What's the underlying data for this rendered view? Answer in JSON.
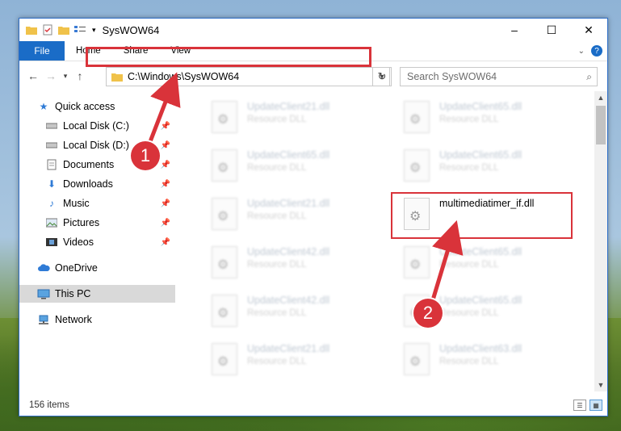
{
  "window": {
    "title": "SysWOW64",
    "controls": {
      "minimize": "–",
      "maximize": "☐",
      "close": "✕"
    }
  },
  "ribbon": {
    "tabs": [
      "File",
      "Home",
      "Share",
      "View"
    ],
    "help": "?"
  },
  "address_bar": {
    "path": "C:\\Windows\\SysWOW64",
    "dropdown_icon": "chevron-down-icon",
    "refresh_icon": "refresh-icon"
  },
  "search": {
    "placeholder": "Search SysWOW64"
  },
  "sidebar": {
    "items": [
      {
        "label": "Quick access",
        "icon": "star-icon"
      },
      {
        "label": "Local Disk (C:)",
        "icon": "disk-icon"
      },
      {
        "label": "Local Disk (D:)",
        "icon": "disk-icon"
      },
      {
        "label": "Documents",
        "icon": "documents-icon"
      },
      {
        "label": "Downloads",
        "icon": "download-icon"
      },
      {
        "label": "Music",
        "icon": "music-icon"
      },
      {
        "label": "Pictures",
        "icon": "pictures-icon"
      },
      {
        "label": "Videos",
        "icon": "videos-icon"
      },
      {
        "label": "OneDrive",
        "icon": "cloud-icon"
      },
      {
        "label": "This PC",
        "icon": "computer-icon"
      },
      {
        "label": "Network",
        "icon": "network-icon"
      }
    ]
  },
  "files": [
    {
      "name": "UpdateClient21.dll",
      "type": "Resource DLL"
    },
    {
      "name": "UpdateClient65.dll",
      "type": "Resource DLL"
    },
    {
      "name": "UpdateClient65.dll",
      "type": "Resource DLL"
    },
    {
      "name": "UpdateClient65.dll",
      "type": "Resource DLL"
    },
    {
      "name": "UpdateClient21.dll",
      "type": "Resource DLL"
    },
    {
      "name": "multimediatimer_if.dll",
      "type": ""
    },
    {
      "name": "UpdateClient42.dll",
      "type": "Resource DLL"
    },
    {
      "name": "UpdateClient65.dll",
      "type": "Resource DLL"
    },
    {
      "name": "UpdateClient42.dll",
      "type": "Resource DLL"
    },
    {
      "name": "UpdateClient65.dll",
      "type": "Resource DLL"
    },
    {
      "name": "UpdateClient21.dll",
      "type": "Resource DLL"
    },
    {
      "name": "UpdateClient63.dll",
      "type": "Resource DLL"
    }
  ],
  "status": {
    "item_count": "156 items"
  },
  "annotations": {
    "step1": "1",
    "step2": "2"
  },
  "colors": {
    "accent": "#1a6cc7",
    "highlight": "#d9333a"
  }
}
